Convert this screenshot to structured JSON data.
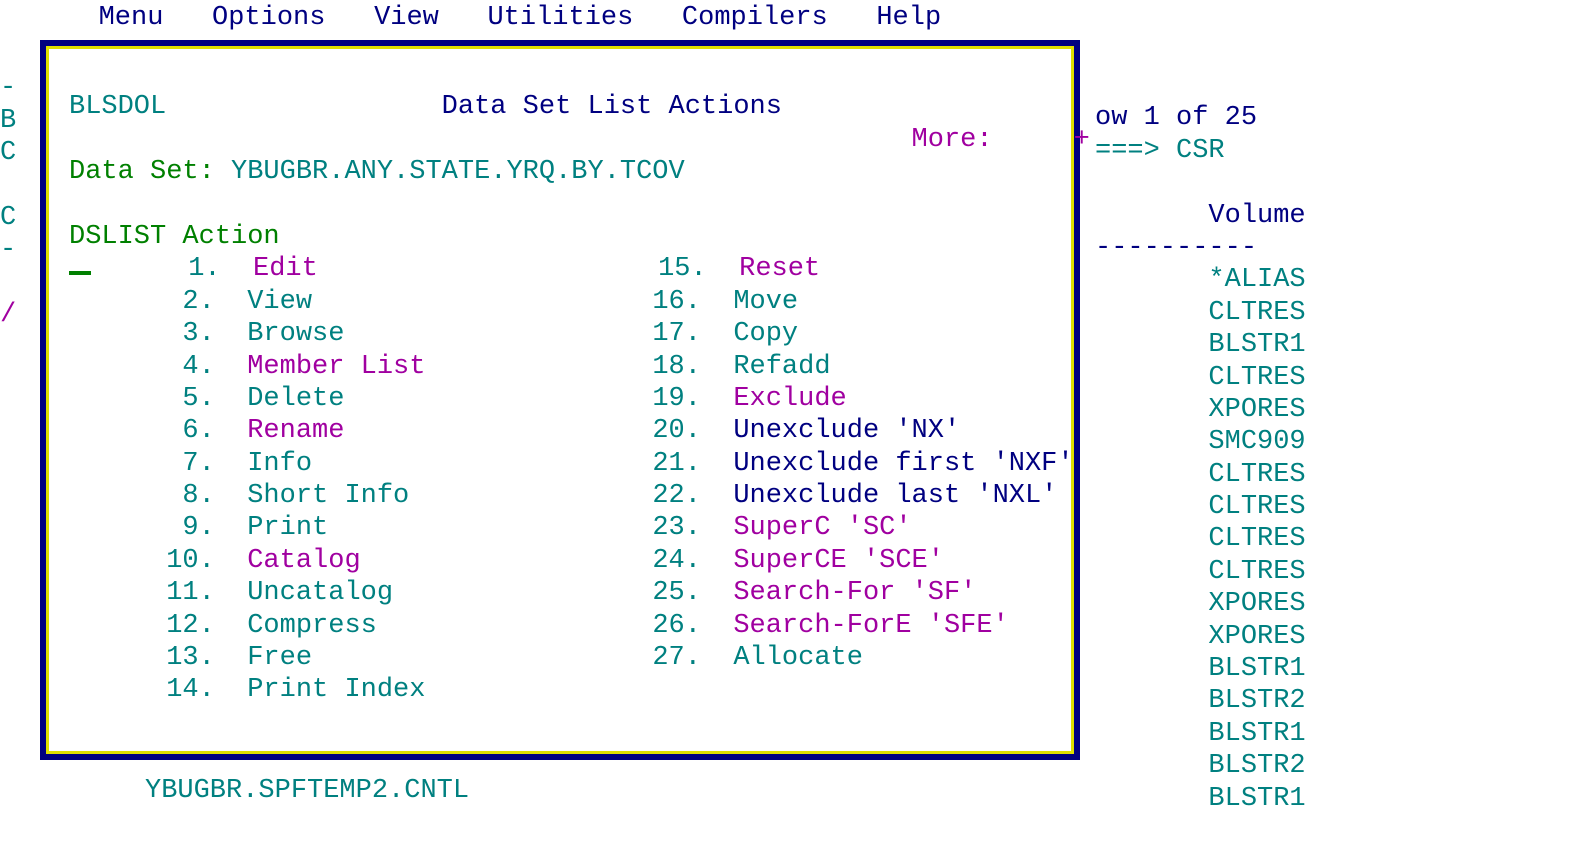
{
  "menu": [
    "Menu",
    "Options",
    "View",
    "Utilities",
    "Compilers",
    "Help"
  ],
  "left_margin": {
    "dash1": "-",
    "b": "B",
    "c1": "C",
    "c2": "C",
    "dash2": "-",
    "slash": "/"
  },
  "popup": {
    "panel_id": "BLSDOL",
    "title": "Data Set List Actions",
    "more_label": "More:",
    "more_symbol": "+",
    "dataset_label": "Data Set:",
    "dataset_name": "YBUGBR.ANY.STATE.YRQ.BY.TCOV",
    "actions_label": "DSLIST Action",
    "col1": [
      {
        "n": "1.",
        "t": "Edit",
        "c": "mag"
      },
      {
        "n": "2.",
        "t": "View",
        "c": "teal"
      },
      {
        "n": "3.",
        "t": "Browse",
        "c": "teal"
      },
      {
        "n": "4.",
        "t": "Member List",
        "c": "mag"
      },
      {
        "n": "5.",
        "t": "Delete",
        "c": "teal"
      },
      {
        "n": "6.",
        "t": "Rename",
        "c": "mag"
      },
      {
        "n": "7.",
        "t": "Info",
        "c": "teal"
      },
      {
        "n": "8.",
        "t": "Short Info",
        "c": "teal"
      },
      {
        "n": "9.",
        "t": "Print",
        "c": "teal"
      },
      {
        "n": "10.",
        "t": "Catalog",
        "c": "mag"
      },
      {
        "n": "11.",
        "t": "Uncatalog",
        "c": "teal"
      },
      {
        "n": "12.",
        "t": "Compress",
        "c": "teal"
      },
      {
        "n": "13.",
        "t": "Free",
        "c": "teal"
      },
      {
        "n": "14.",
        "t": "Print Index",
        "c": "teal"
      }
    ],
    "col2": [
      {
        "n": "15.",
        "t": "Reset",
        "c": "mag"
      },
      {
        "n": "16.",
        "t": "Move",
        "c": "teal"
      },
      {
        "n": "17.",
        "t": "Copy",
        "c": "teal"
      },
      {
        "n": "18.",
        "t": "Refadd",
        "c": "teal"
      },
      {
        "n": "19.",
        "t": "Exclude",
        "c": "mag"
      },
      {
        "n": "20.",
        "t": "Unexclude 'NX'",
        "c": "blue"
      },
      {
        "n": "21.",
        "t": "Unexclude first 'NXF'",
        "c": "blue"
      },
      {
        "n": "22.",
        "t": "Unexclude last 'NXL'",
        "c": "blue"
      },
      {
        "n": "23.",
        "t": "SuperC 'SC'",
        "c": "mag"
      },
      {
        "n": "24.",
        "t": "SuperCE 'SCE'",
        "c": "mag"
      },
      {
        "n": "25.",
        "t": "Search-For 'SF'",
        "c": "mag"
      },
      {
        "n": "26.",
        "t": "Search-ForE 'SFE'",
        "c": "mag"
      },
      {
        "n": "27.",
        "t": "Allocate",
        "c": "teal"
      }
    ]
  },
  "right": {
    "row_label": "ow 1 of 25",
    "scroll_label": "===>",
    "scroll_value": "CSR",
    "volume_header": "Volume",
    "volume_dashes": "----------",
    "volumes": [
      "*ALIAS",
      "CLTRES",
      "BLSTR1",
      "CLTRES",
      "XPORES",
      "SMC909",
      "CLTRES",
      "CLTRES",
      "CLTRES",
      "CLTRES",
      "XPORES",
      "XPORES",
      "BLSTR1",
      "BLSTR2",
      "BLSTR1",
      "BLSTR2",
      "BLSTR1"
    ]
  },
  "bottom_dataset": "YBUGBR.SPFTEMP2.CNTL",
  "colors": {
    "blue": "#000080",
    "teal": "#008080",
    "green": "#008000",
    "mag": "#a000a0"
  }
}
